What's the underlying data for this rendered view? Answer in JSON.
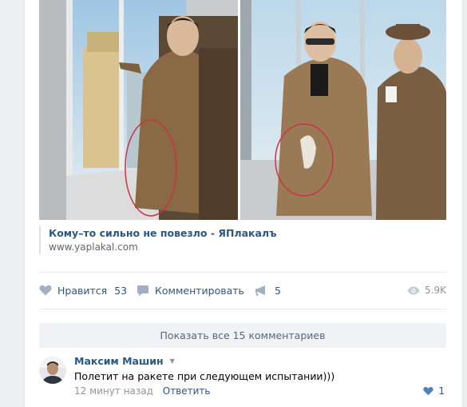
{
  "link": {
    "title": "Кому–то сильно не повезло - ЯПлакалъ",
    "url": "www.yaplakal.com"
  },
  "actions": {
    "like_label": "Нравится",
    "like_count": "53",
    "comment_label": "Комментировать",
    "share_count": "5",
    "views": "5.9K"
  },
  "comments": {
    "show_all": "Показать все 15 комментариев",
    "items": [
      {
        "author": "Максим Машин",
        "text": "Полетит на ракете при следующем испытании)))",
        "time": "12 минут назад",
        "reply_label": "Ответить",
        "likes": "1"
      }
    ]
  },
  "colors": {
    "link": "#2a5885",
    "muted": "#939393",
    "background": "#edeef0",
    "show_all_bg": "#f0f2f5"
  },
  "icons": [
    "heart-icon",
    "comment-icon",
    "megaphone-icon",
    "eye-icon",
    "caret-down-icon"
  ]
}
